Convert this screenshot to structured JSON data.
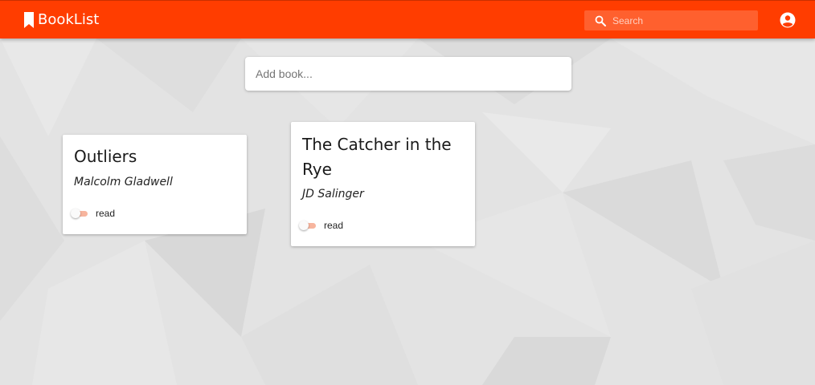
{
  "colors": {
    "header": "#ff3d00",
    "background": "#e3e3e3",
    "switch_track": "#f7b59e"
  },
  "header": {
    "app_title": "BookList",
    "brand_icon": "bookmark-icon",
    "search": {
      "placeholder": "Search",
      "value": "",
      "icon": "search-icon"
    },
    "account_icon": "account-circle-icon"
  },
  "add_book": {
    "placeholder": "Add book...",
    "value": ""
  },
  "books": [
    {
      "title": "Outliers",
      "author": "Malcolm Gladwell",
      "read_label": "read",
      "read": false
    },
    {
      "title": "The Catcher in the Rye",
      "author": "JD Salinger",
      "read_label": "read",
      "read": false
    }
  ]
}
